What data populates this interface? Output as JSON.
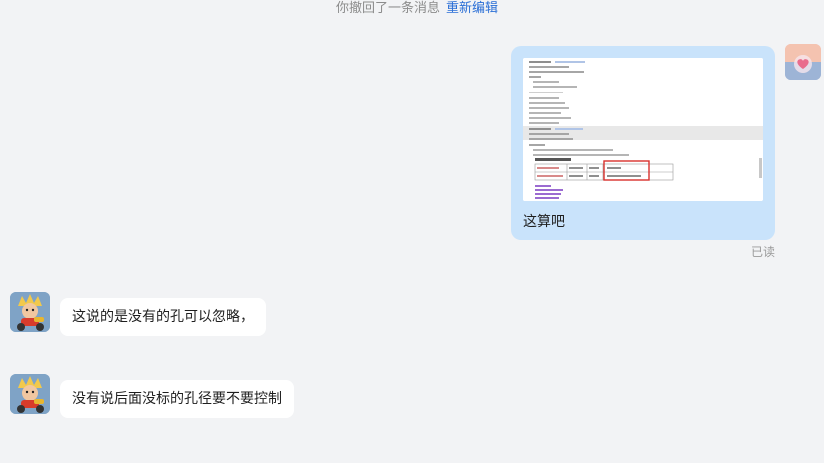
{
  "notice": {
    "text": "你撤回了一条消息",
    "reedit_label": "重新编辑"
  },
  "messages": [
    {
      "direction": "outgoing",
      "has_image": true,
      "text": "这算吧",
      "status": "已读"
    },
    {
      "direction": "incoming",
      "text": "这说的是没有的孔可以忽略，"
    },
    {
      "direction": "incoming",
      "text": "没有说后面没标的孔径要不要控制"
    }
  ],
  "colors": {
    "background": "#f2f3f5",
    "outgoing_bubble": "#c9e3fb",
    "incoming_bubble": "#ffffff",
    "link": "#2b6fd6",
    "highlight_box": "#d9302c"
  }
}
